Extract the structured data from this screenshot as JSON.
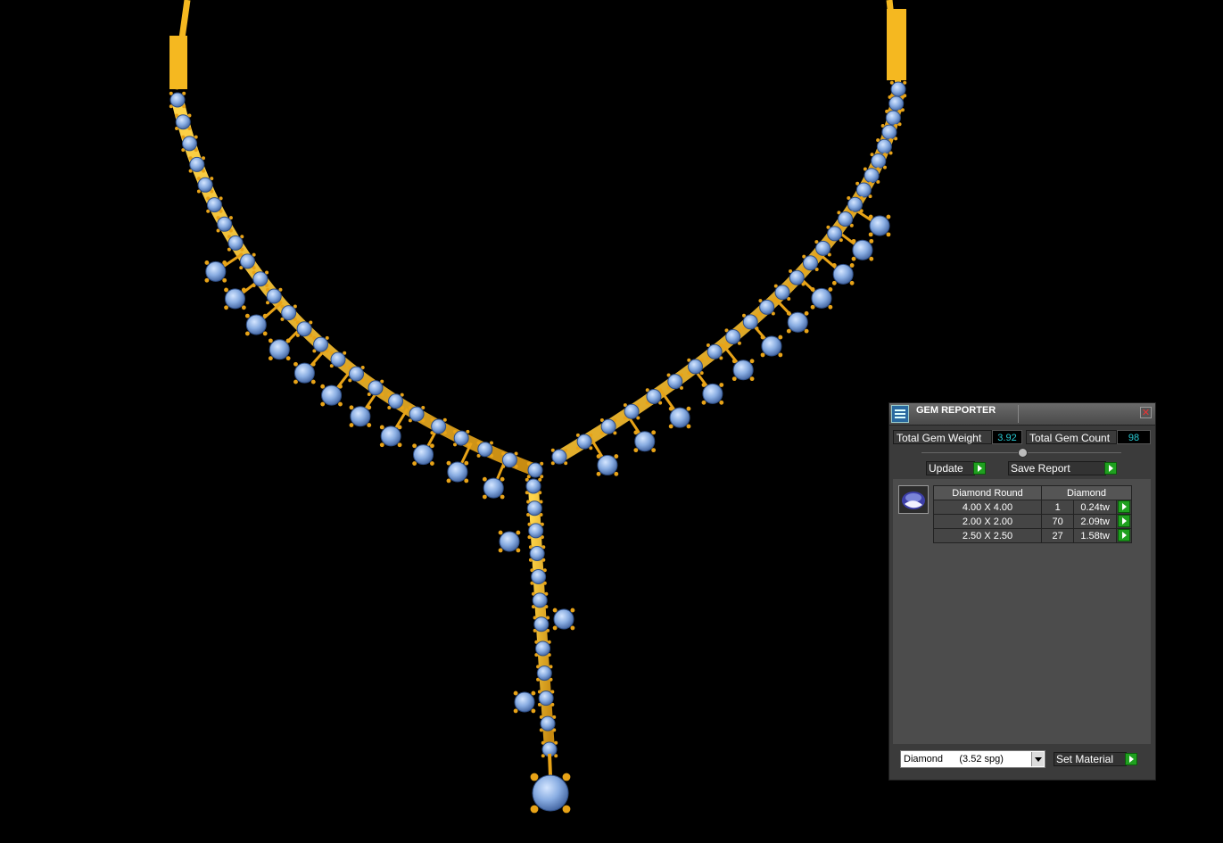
{
  "panel": {
    "title": "GEM REPORTER",
    "close_symbol": "✕",
    "total_weight_label": "Total Gem Weight",
    "total_weight_value": "3.92",
    "total_count_label": "Total Gem Count",
    "total_count_value": "98",
    "update_label": "Update",
    "save_report_label": "Save Report",
    "table": {
      "headers": [
        "Diamond Round",
        "",
        "Diamond"
      ],
      "rows": [
        {
          "size": "4.00 X 4.00",
          "count": "1",
          "weight": "0.24tw"
        },
        {
          "size": "2.00 X 2.00",
          "count": "70",
          "weight": "2.09tw"
        },
        {
          "size": "2.50 X 2.50",
          "count": "27",
          "weight": "1.58tw"
        }
      ]
    },
    "material_value": "Diamond      (3.52 spg)",
    "set_material_label": "Set Material"
  },
  "colors": {
    "background": "#000000",
    "gold": "#e8a317",
    "gem": "#8fb4e8",
    "accent_cyan": "#27c9d3",
    "go_green": "#1fa01f"
  },
  "icons": {
    "title": "gem-reporter-app-icon",
    "close": "close-icon",
    "go": "play-arrow-icon",
    "gem": "round-gem-icon",
    "dropdown": "chevron-down-icon"
  }
}
